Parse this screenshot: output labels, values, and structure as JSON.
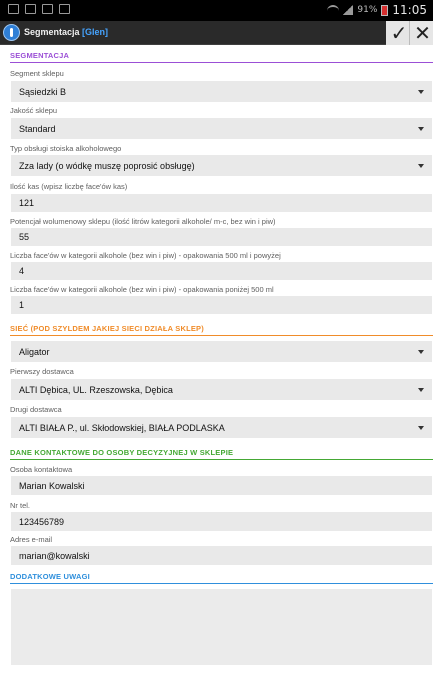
{
  "status_bar": {
    "battery": "91%",
    "time": "11:05"
  },
  "action_bar": {
    "title": "Segmentacja",
    "user_tag": "[Glen]",
    "ok_icon": "check-icon",
    "cancel_icon": "close-icon"
  },
  "colors": {
    "segmentation": "#9b4fd6",
    "network": "#f08c2a",
    "contact": "#45a835",
    "notes": "#2f8fdc"
  },
  "sections": {
    "segmentation": "SEGMENTACJA",
    "network": "SIEĆ (POD SZYLDEM JAKIEJ SIECI DZIAŁA SKLEP)",
    "contact": "DANE KONTAKTOWE DO OSOBY DECYZYJNEJ W SKLEPIE",
    "notes": "DODATKOWE UWAGI"
  },
  "fields": {
    "segment": {
      "label": "Segment sklepu",
      "value": "Sąsiedzki B"
    },
    "quality": {
      "label": "Jakość sklepu",
      "value": "Standard"
    },
    "alcohol_service": {
      "label": "Typ obsługi stoiska alkoholowego",
      "value": "Zza lady (o wódkę muszę poprosić obsługę)"
    },
    "checkouts": {
      "label": "Ilość kas (wpisz liczbę face'ów kas)",
      "value": "121"
    },
    "volume_potential": {
      "label": "Potencjał wolumenowy sklepu (ilość litrów kategorii alkohole/ m-c, bez win i piw)",
      "value": "55"
    },
    "faces_large": {
      "label": "Liczba face'ów w kategorii alkohole (bez win i piw) - opakowania 500 ml i powyżej",
      "value": "4"
    },
    "faces_small": {
      "label": "Liczba face'ów w kategorii alkohole (bez win i piw) - opakowania poniżej 500 ml",
      "value": "1"
    },
    "network": {
      "value": "Aligator"
    },
    "supplier1": {
      "label": "Pierwszy dostawca",
      "value": "ALTI Dębica, UL. Rzeszowska, Dębica"
    },
    "supplier2": {
      "label": "Drugi dostawca",
      "value": "ALTI BIAŁA P., ul. Skłodowskiej, BIAŁA PODLASKA"
    },
    "contact_person": {
      "label": "Osoba kontaktowa",
      "value": "Marian Kowalski"
    },
    "phone": {
      "label": "Nr tel.",
      "value": "123456789"
    },
    "email": {
      "label": "Adres e-mail",
      "value": "marian@kowalski"
    }
  }
}
